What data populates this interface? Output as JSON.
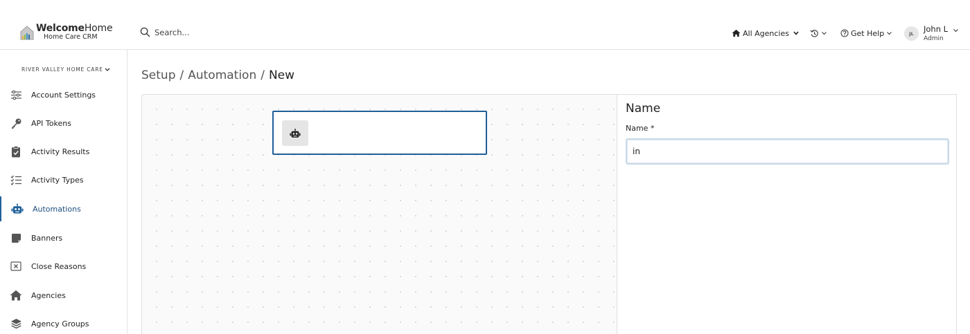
{
  "header": {
    "logo_bold": "Welcome",
    "logo_light": "Home",
    "logo_sub": "Home Care CRM",
    "search_placeholder": "Search...",
    "agencies_label": "All Agencies",
    "help_label": "Get Help",
    "user": {
      "initials": "JL",
      "name": "John L",
      "role": "Admin"
    }
  },
  "sidebar": {
    "org_name": "RIVER VALLEY HOME CARE",
    "items": [
      {
        "label": "Account Settings",
        "icon": "sliders-icon"
      },
      {
        "label": "API Tokens",
        "icon": "key-icon"
      },
      {
        "label": "Activity Results",
        "icon": "clipboard-check-icon"
      },
      {
        "label": "Activity Types",
        "icon": "checklist-icon"
      },
      {
        "label": "Automations",
        "icon": "robot-icon",
        "active": true
      },
      {
        "label": "Banners",
        "icon": "note-icon"
      },
      {
        "label": "Close Reasons",
        "icon": "close-box-icon"
      },
      {
        "label": "Agencies",
        "icon": "house-icon"
      },
      {
        "label": "Agency Groups",
        "icon": "layers-icon"
      }
    ]
  },
  "breadcrumb": {
    "items": [
      "Setup",
      "Automation"
    ],
    "current": "New",
    "separator": "/"
  },
  "panel": {
    "title": "Name",
    "field_label": "Name *",
    "field_value": "in"
  },
  "colors": {
    "accent": "#1f5f99",
    "border": "#dedede",
    "canvas_bg": "#fafafa"
  }
}
